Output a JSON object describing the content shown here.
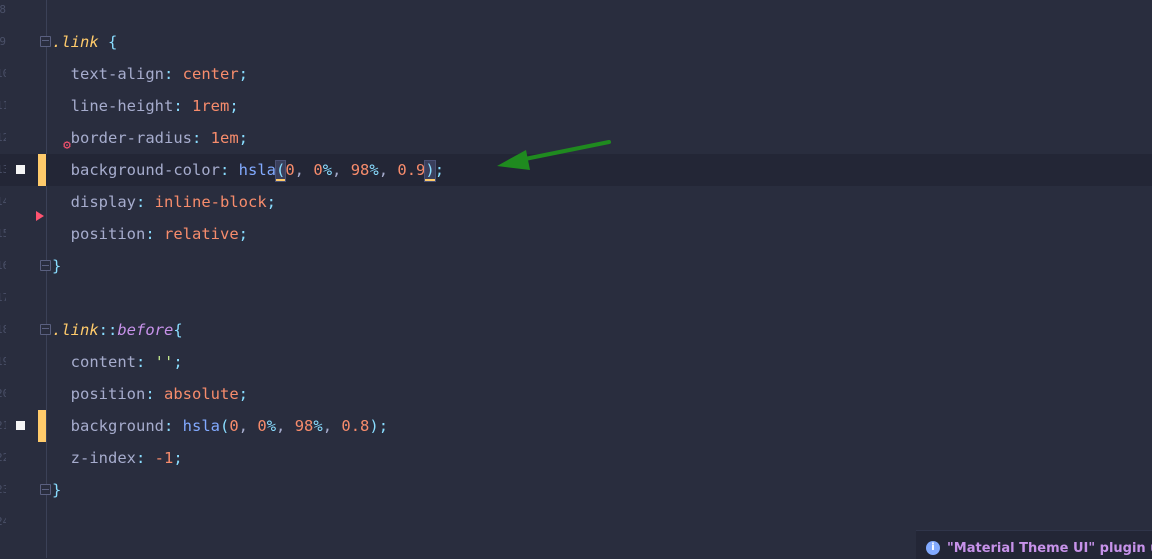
{
  "editor": {
    "lines": [
      {
        "num": "8",
        "tokens": []
      },
      {
        "num": "9",
        "tokens": [
          {
            "c": "sel",
            "t": ".link"
          },
          {
            "c": "plain",
            "t": " "
          },
          {
            "c": "punc",
            "t": "{"
          }
        ]
      },
      {
        "num": "10",
        "tokens": [
          {
            "c": "prop",
            "t": "  text-align"
          },
          {
            "c": "punc",
            "t": ": "
          },
          {
            "c": "val",
            "t": "center"
          },
          {
            "c": "punc",
            "t": ";"
          }
        ]
      },
      {
        "num": "11",
        "tokens": [
          {
            "c": "prop",
            "t": "  line-height"
          },
          {
            "c": "punc",
            "t": ": "
          },
          {
            "c": "num",
            "t": "1rem"
          },
          {
            "c": "punc",
            "t": ";"
          }
        ]
      },
      {
        "num": "12",
        "tokens": [
          {
            "c": "prop",
            "t": "  border-radius"
          },
          {
            "c": "punc",
            "t": ": "
          },
          {
            "c": "num",
            "t": "1em"
          },
          {
            "c": "punc",
            "t": ";"
          }
        ]
      },
      {
        "num": "13",
        "tokens": [
          {
            "c": "prop",
            "t": "  background-color"
          },
          {
            "c": "punc",
            "t": ": "
          },
          {
            "c": "fn",
            "t": "hsla"
          },
          {
            "c": "punc brace-hl caret-after",
            "t": "("
          },
          {
            "c": "num",
            "t": "0"
          },
          {
            "c": "plain",
            "t": ", "
          },
          {
            "c": "num",
            "t": "0"
          },
          {
            "c": "pct",
            "t": "%"
          },
          {
            "c": "plain",
            "t": ", "
          },
          {
            "c": "num",
            "t": "98"
          },
          {
            "c": "pct",
            "t": "%"
          },
          {
            "c": "plain",
            "t": ", "
          },
          {
            "c": "num",
            "t": "0.9"
          },
          {
            "c": "punc brace-hl caret-after",
            "t": ")"
          },
          {
            "c": "punc",
            "t": ";"
          }
        ]
      },
      {
        "num": "14",
        "tokens": [
          {
            "c": "prop",
            "t": "  display"
          },
          {
            "c": "punc",
            "t": ": "
          },
          {
            "c": "val",
            "t": "inline-block"
          },
          {
            "c": "punc",
            "t": ";"
          }
        ]
      },
      {
        "num": "15",
        "tokens": [
          {
            "c": "prop",
            "t": "  position"
          },
          {
            "c": "punc",
            "t": ": "
          },
          {
            "c": "val",
            "t": "relative"
          },
          {
            "c": "punc",
            "t": ";"
          }
        ]
      },
      {
        "num": "16",
        "tokens": [
          {
            "c": "punc",
            "t": "}"
          }
        ]
      },
      {
        "num": "17",
        "tokens": []
      },
      {
        "num": "18",
        "tokens": [
          {
            "c": "sel",
            "t": ".link"
          },
          {
            "c": "punc",
            "t": "::"
          },
          {
            "c": "pseudo",
            "t": "before"
          },
          {
            "c": "punc",
            "t": "{"
          }
        ]
      },
      {
        "num": "19",
        "tokens": [
          {
            "c": "prop",
            "t": "  content"
          },
          {
            "c": "punc",
            "t": ": "
          },
          {
            "c": "str",
            "t": "''"
          },
          {
            "c": "punc",
            "t": ";"
          }
        ]
      },
      {
        "num": "20",
        "tokens": [
          {
            "c": "prop",
            "t": "  position"
          },
          {
            "c": "punc",
            "t": ": "
          },
          {
            "c": "val",
            "t": "absolute"
          },
          {
            "c": "punc",
            "t": ";"
          }
        ]
      },
      {
        "num": "21",
        "tokens": [
          {
            "c": "prop",
            "t": "  background"
          },
          {
            "c": "punc",
            "t": ": "
          },
          {
            "c": "fn",
            "t": "hsla"
          },
          {
            "c": "punc",
            "t": "("
          },
          {
            "c": "num",
            "t": "0"
          },
          {
            "c": "plain",
            "t": ", "
          },
          {
            "c": "num",
            "t": "0"
          },
          {
            "c": "pct",
            "t": "%"
          },
          {
            "c": "plain",
            "t": ", "
          },
          {
            "c": "num",
            "t": "98"
          },
          {
            "c": "pct",
            "t": "%"
          },
          {
            "c": "plain",
            "t": ", "
          },
          {
            "c": "num",
            "t": "0.8"
          },
          {
            "c": "punc",
            "t": ");"
          }
        ]
      },
      {
        "num": "22",
        "tokens": [
          {
            "c": "prop",
            "t": "  z-index"
          },
          {
            "c": "punc",
            "t": ": "
          },
          {
            "c": "num",
            "t": "-1"
          },
          {
            "c": "punc",
            "t": ";"
          }
        ]
      },
      {
        "num": "23",
        "tokens": [
          {
            "c": "punc",
            "t": "}"
          }
        ]
      },
      {
        "num": "24",
        "tokens": []
      }
    ],
    "colors": {
      "background": "#292d3e",
      "current_line": "#232636",
      "change_marker": "#ffcb6b",
      "arrow": "#1f8a1f"
    }
  },
  "notification": {
    "icon": "info-icon",
    "text": "\"Material Theme UI\" plugin u"
  }
}
